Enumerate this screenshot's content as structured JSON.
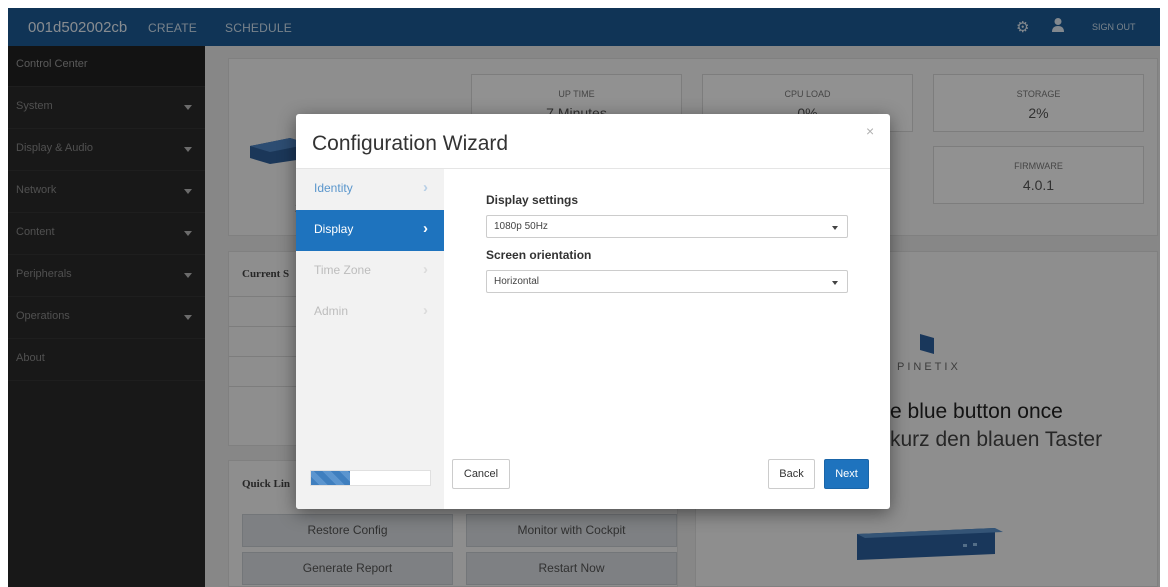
{
  "topbar": {
    "device_id": "001d502002cb",
    "nav": [
      "CREATE",
      "SCHEDULE"
    ],
    "settings_icon": "gears-icon",
    "user_icon": "user-icon",
    "sign_out": "SIGN OUT"
  },
  "sidebar": {
    "items": [
      {
        "label": "Control Center",
        "has_submenu": false
      },
      {
        "label": "System",
        "has_submenu": true
      },
      {
        "label": "Display & Audio",
        "has_submenu": true
      },
      {
        "label": "Network",
        "has_submenu": true
      },
      {
        "label": "Content",
        "has_submenu": true
      },
      {
        "label": "Peripherals",
        "has_submenu": true
      },
      {
        "label": "Operations",
        "has_submenu": true
      },
      {
        "label": "About",
        "has_submenu": false
      }
    ]
  },
  "dashboard": {
    "stats": [
      {
        "title": "UP TIME",
        "value": "7 Minutes"
      },
      {
        "title": "CPU LOAD",
        "value": "0%"
      },
      {
        "title": "STORAGE",
        "value": "2%"
      },
      {
        "title": "FIRMWARE",
        "value": "4.0.1"
      }
    ],
    "current_status_label": "Current S",
    "quick_links_label": "Quick Lin",
    "quick_links": [
      "Restore Config",
      "Monitor with Cockpit",
      "Generate Report",
      "Restart Now"
    ],
    "brand": "PINETIX",
    "instruction_en": "e blue button once",
    "instruction_de": "kurz den blauen Taster",
    "device_left_fragment": "2"
  },
  "wizard": {
    "title": "Configuration Wizard",
    "close": "×",
    "steps": [
      {
        "label": "Identity",
        "state": "done"
      },
      {
        "label": "Display",
        "state": "active"
      },
      {
        "label": "Time Zone",
        "state": "todo"
      },
      {
        "label": "Admin",
        "state": "todo"
      }
    ],
    "progress_fraction": 0.33,
    "display_settings_label": "Display settings",
    "display_settings_value": "1080p 50Hz",
    "screen_orientation_label": "Screen orientation",
    "screen_orientation_value": "Horizontal",
    "cancel_label": "Cancel",
    "back_label": "Back",
    "next_label": "Next"
  },
  "colors": {
    "topbar": "#1c5b94",
    "sidebar": "#2a2a2a",
    "accent": "#1e73be"
  }
}
